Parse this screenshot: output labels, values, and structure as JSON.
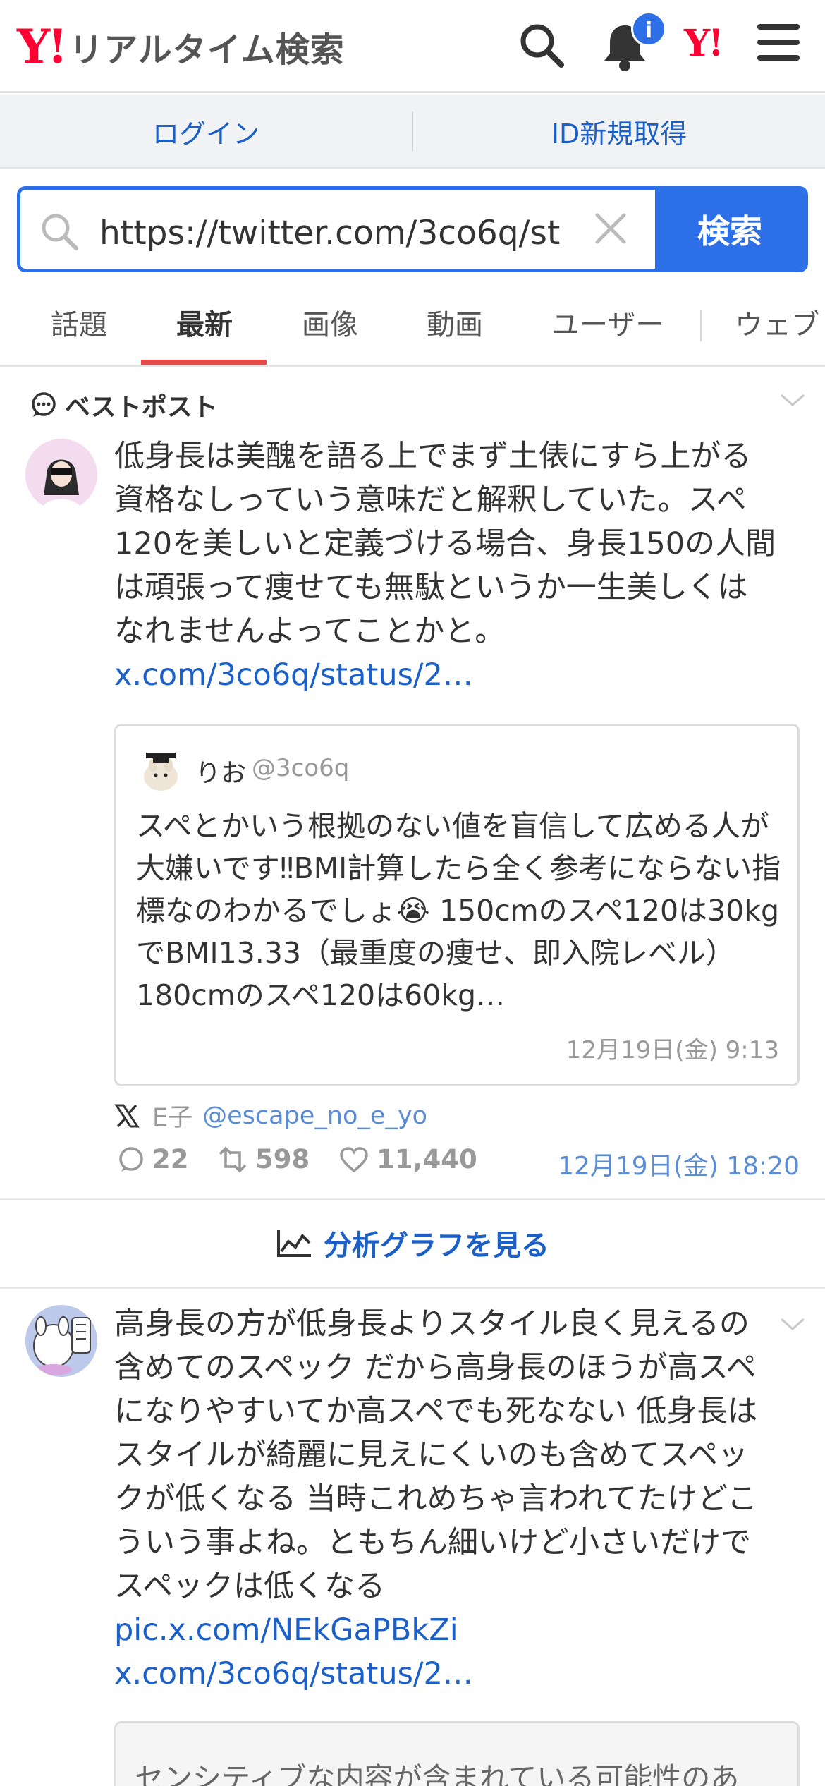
{
  "header": {
    "logo_mark": "Y!",
    "logo_text": "リアルタイム検索",
    "notification_badge": "i",
    "yahoo_mini_logo": "Y!",
    "icons": [
      "search-icon",
      "bell-icon",
      "yahoo-icon",
      "menu-icon"
    ]
  },
  "loginbar": {
    "login": "ログイン",
    "signup": "ID新規取得"
  },
  "search": {
    "value": "https://twitter.com/3co6q/st",
    "button": "検索"
  },
  "tabs": [
    {
      "label": "話題"
    },
    {
      "label": "最新",
      "active": true
    },
    {
      "label": "画像"
    },
    {
      "label": "動画"
    },
    {
      "label": "ユーザー"
    },
    {
      "label": "ウェブ"
    }
  ],
  "best_post": {
    "section_label": "ベストポスト",
    "text": "低身長は美醜を語る上でまず土俵にすら上がる資格なしっていう意味だと解釈していた。スペ120を美しいと定義づける場合、身長150の人間は頑張って痩せても無駄というか一生美しくはなれませんよってことかと。",
    "link": "x.com/3co6q/status/2…",
    "quote": {
      "name": "りお",
      "handle": "@3co6q",
      "text": "スペとかいう根拠のない値を盲信して広める人が大嫌いです‼BMI計算したら全く参考にならない指標なのわかるでしょ😭 150cmのスペ120は30kgでBMI13.33（最重度の痩せ、即入院レベル） 180cmのスペ120は60kg…",
      "time": "12月19日(金) 9:13"
    },
    "author_name": "E子",
    "author_handle": "@escape_no_e_yo",
    "replies": "22",
    "reposts": "598",
    "likes": "11,440",
    "time": "12月19日(金) 18:20"
  },
  "graph_link": "分析グラフを見る",
  "second_post": {
    "text": "高身長の方が低身長よりスタイル良く見えるの含めてのスペック だから高身長のほうが高スペになりやすいてか高スペでも死なない 低身長はスタイルが綺麗に見えにくいのも含めてスペックが低くなる 当時これめちゃ言われてたけどこういう事よね。ともちん細いけど小さいだけでスペックは低くなる",
    "link1": "pic.x.com/NEkGaPBkZi",
    "link2": "x.com/3co6q/status/2…",
    "sensitive_notice": "センシティブな内容が含まれている可能性のあ"
  },
  "colors": {
    "brand_red": "#ff0033",
    "accent_blue": "#2c6fe6",
    "link_blue": "#1b5fc9",
    "tab_underline": "#e54b4b"
  }
}
